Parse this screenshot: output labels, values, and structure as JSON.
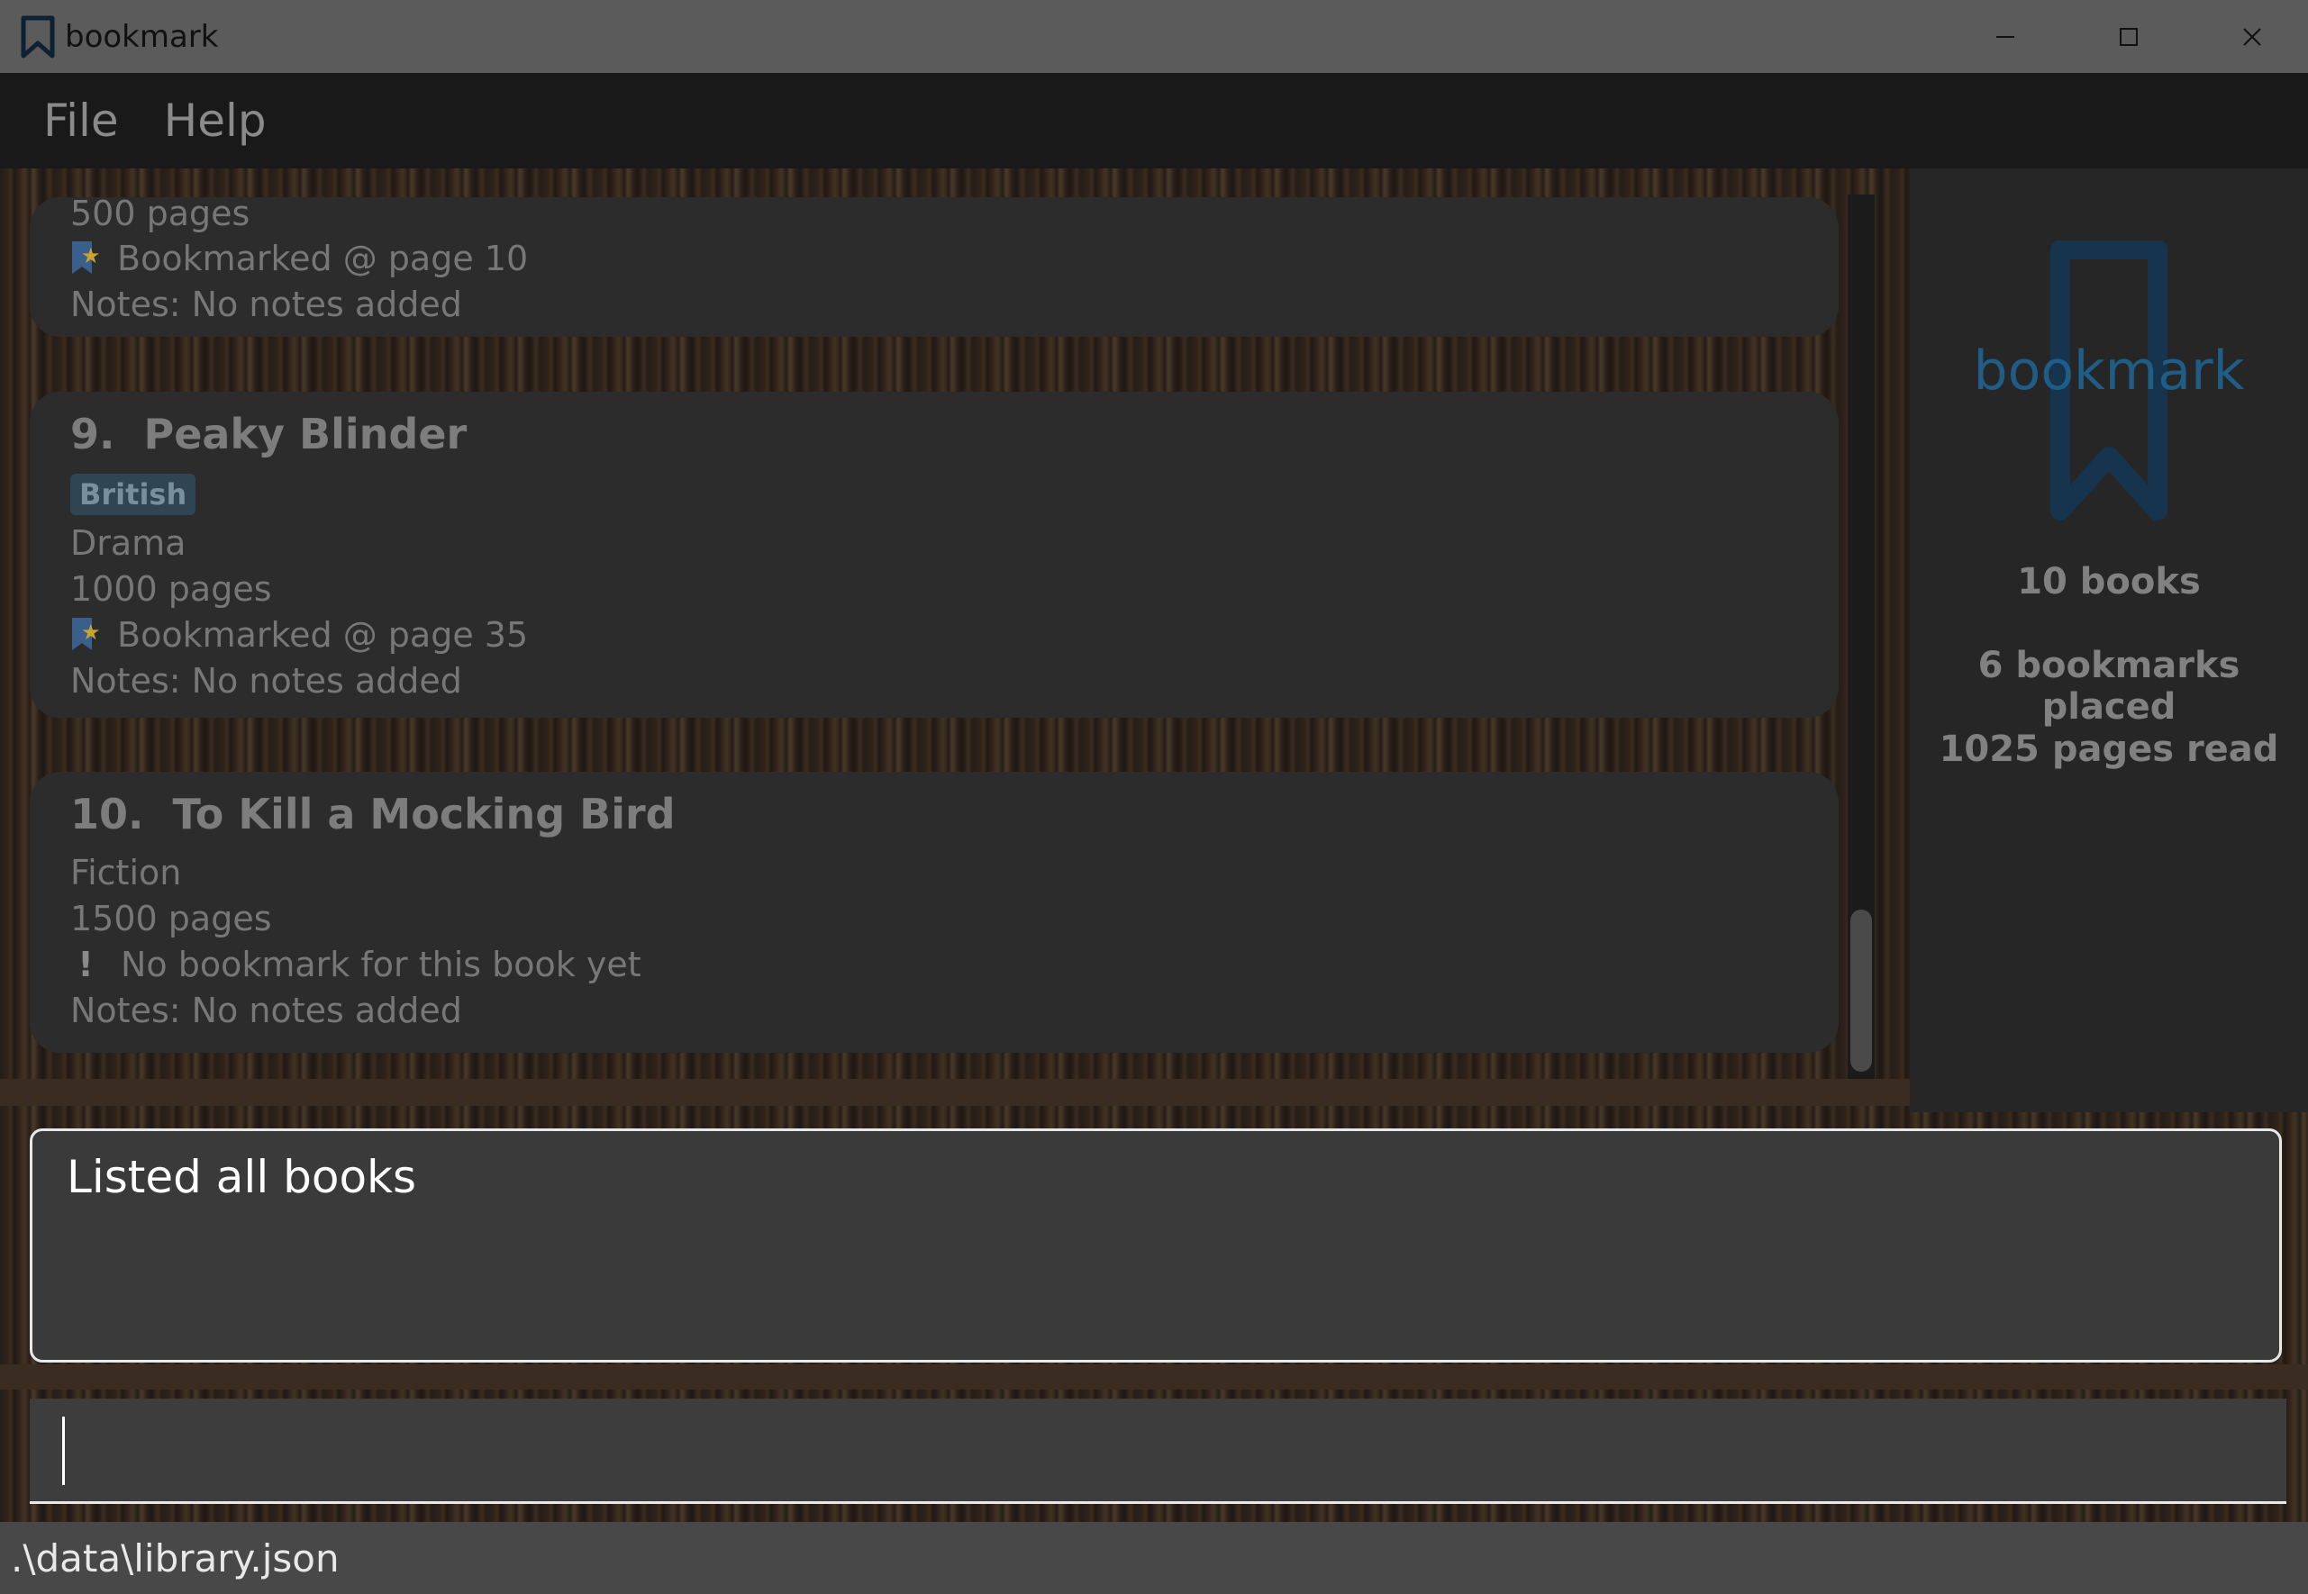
{
  "window": {
    "title": "bookmark"
  },
  "menu": {
    "file": "File",
    "help": "Help"
  },
  "books": [
    {
      "partial": true,
      "pages": "500 pages",
      "bookmark": "Bookmarked @ page 10",
      "notes": "Notes: No notes added"
    },
    {
      "index": "9.",
      "title": "Peaky Blinder",
      "tag": "British",
      "genre": "Drama",
      "pages": "1000 pages",
      "bookmark": "Bookmarked @ page 35",
      "notes": "Notes: No notes added"
    },
    {
      "index": "10.",
      "title": "To Kill a Mocking Bird",
      "genre": "Fiction",
      "pages": "1500 pages",
      "bookmark": "No bookmark for this book yet",
      "notes": "Notes: No notes added"
    }
  ],
  "stats": {
    "logo_text": "bookmark",
    "books": "10 books",
    "bookmarks": "6 bookmarks placed",
    "pages_read": "1025 pages read"
  },
  "result": {
    "text": "Listed all books"
  },
  "command": {
    "value": ""
  },
  "status": {
    "path": ".\\data\\library.json"
  },
  "colors": {
    "accent": "#1f5c86",
    "tag_bg": "#2f4553",
    "bookmark_flag": "#3a5f8c",
    "bookmark_star": "#c8a431"
  }
}
